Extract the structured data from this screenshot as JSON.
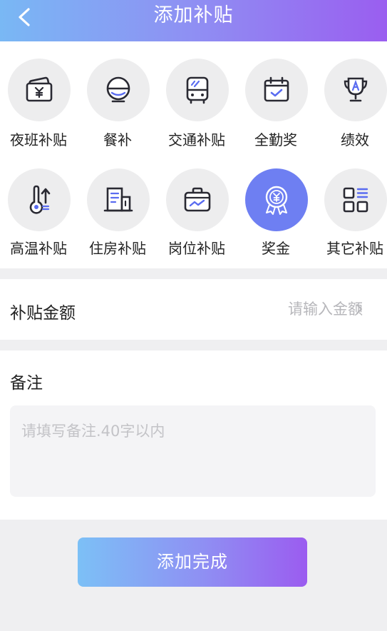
{
  "header": {
    "title": "添加补贴"
  },
  "categories": [
    {
      "label": "夜班补贴",
      "icon": "ticket-icon"
    },
    {
      "label": "餐补",
      "icon": "bowl-icon"
    },
    {
      "label": "交通补贴",
      "icon": "bus-icon"
    },
    {
      "label": "全勤奖",
      "icon": "calendar-check-icon"
    },
    {
      "label": "绩效",
      "icon": "trophy-icon"
    },
    {
      "label": "高温补贴",
      "icon": "thermometer-icon"
    },
    {
      "label": "住房补贴",
      "icon": "building-icon"
    },
    {
      "label": "岗位补贴",
      "icon": "briefcase-icon"
    },
    {
      "label": "奖金",
      "icon": "medal-icon"
    },
    {
      "label": "其它补贴",
      "icon": "grid-icon"
    }
  ],
  "selected_category": "奖金",
  "amount": {
    "label": "补贴金额",
    "placeholder": "请输入金额",
    "value": ""
  },
  "remark": {
    "label": "备注",
    "placeholder": "请填写备注.40字以内",
    "value": ""
  },
  "submit": {
    "label": "添加完成"
  },
  "colors": {
    "accent": "#6e7ff2",
    "gradient_start": "#79b8f4",
    "gradient_end": "#9a5ef0",
    "icon_bg": "#ededee",
    "page_bg": "#efeff1"
  }
}
